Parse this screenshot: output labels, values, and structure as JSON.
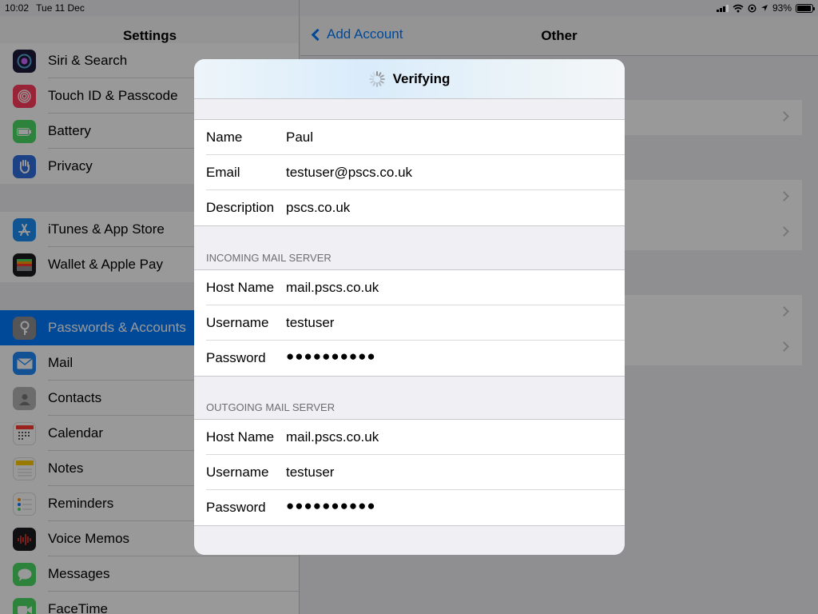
{
  "status_bar": {
    "time": "10:02",
    "date": "Tue 11 Dec",
    "battery": "93%"
  },
  "master": {
    "title": "Settings",
    "items": [
      {
        "label": "Siri & Search",
        "icon": "siri-icon",
        "color": "#1c1c3a"
      },
      {
        "label": "Touch ID & Passcode",
        "icon": "fingerprint-icon",
        "color": "#ff3b5c"
      },
      {
        "label": "Battery",
        "icon": "battery-icon",
        "color": "#4cd964"
      },
      {
        "label": "Privacy",
        "icon": "hand-icon",
        "color": "#2f6fde"
      },
      {
        "label": "iTunes & App Store",
        "icon": "app-store-icon",
        "color": "#1b8cf4"
      },
      {
        "label": "Wallet & Apple Pay",
        "icon": "wallet-icon",
        "color": "#1c1c1e"
      },
      {
        "label": "Passwords & Accounts",
        "icon": "key-icon",
        "color": "#8e8e93"
      },
      {
        "label": "Mail",
        "icon": "mail-icon",
        "color": "#1e88f5"
      },
      {
        "label": "Contacts",
        "icon": "contacts-icon",
        "color": "#b5b5b5"
      },
      {
        "label": "Calendar",
        "icon": "calendar-icon",
        "color": "#ffffff"
      },
      {
        "label": "Notes",
        "icon": "notes-icon",
        "color": "#ffffff"
      },
      {
        "label": "Reminders",
        "icon": "reminders-icon",
        "color": "#ffffff"
      },
      {
        "label": "Voice Memos",
        "icon": "voice-memos-icon",
        "color": "#1c1c1e"
      },
      {
        "label": "Messages",
        "icon": "messages-icon",
        "color": "#4cd964"
      },
      {
        "label": "FaceTime",
        "icon": "facetime-icon",
        "color": "#4cd964"
      }
    ]
  },
  "detail": {
    "back_label": "Add Account",
    "title": "Other"
  },
  "sheet": {
    "title": "Verifying",
    "account": {
      "name_label": "Name",
      "name_value": "Paul",
      "email_label": "Email",
      "email_value": "testuser@pscs.co.uk",
      "description_label": "Description",
      "description_value": "pscs.co.uk"
    },
    "incoming": {
      "header": "INCOMING MAIL SERVER",
      "host_label": "Host Name",
      "host_value": "mail.pscs.co.uk",
      "username_label": "Username",
      "username_value": "testuser",
      "password_label": "Password",
      "password_value": "●●●●●●●●●●"
    },
    "outgoing": {
      "header": "OUTGOING MAIL SERVER",
      "host_label": "Host Name",
      "host_value": "mail.pscs.co.uk",
      "username_label": "Username",
      "username_value": "testuser",
      "password_label": "Password",
      "password_value": "●●●●●●●●●●"
    }
  },
  "colors": {
    "accent": "#007aff",
    "selected_row": "#007aff"
  }
}
